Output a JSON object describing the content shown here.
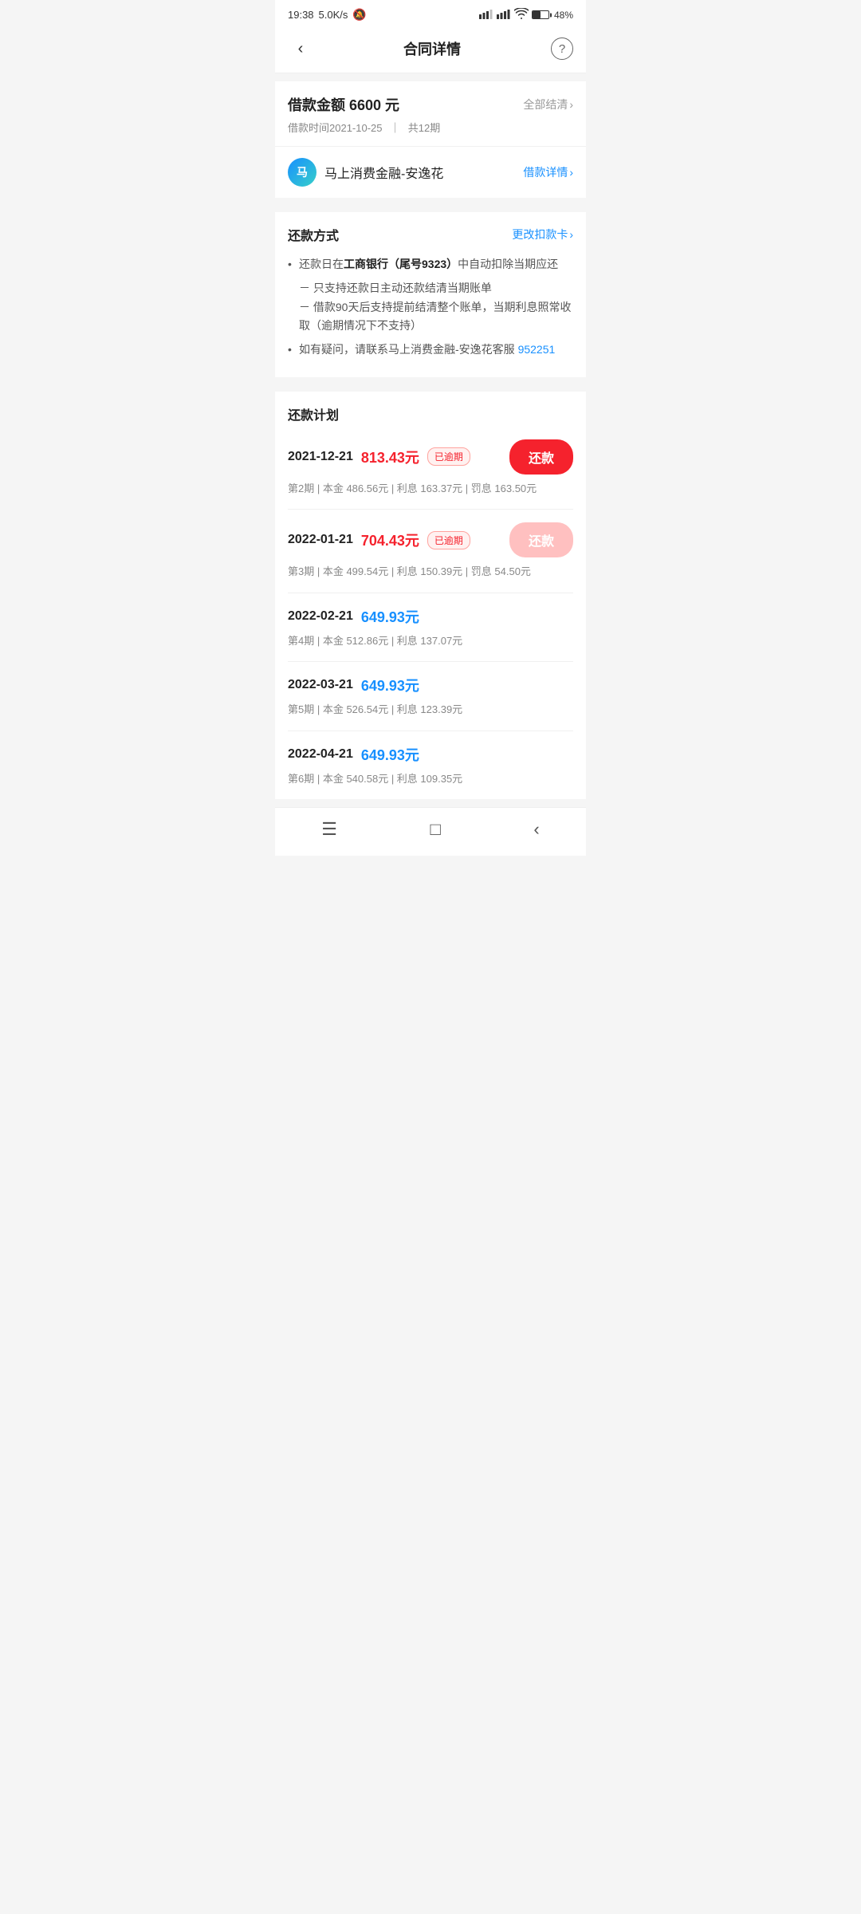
{
  "statusBar": {
    "time": "19:38",
    "network": "5.0K/s",
    "battery": "48%"
  },
  "nav": {
    "title": "合同详情",
    "helpLabel": "?",
    "backLabel": "‹"
  },
  "loanSummary": {
    "title": "借款金额 6600 元",
    "settleAll": "全部结清",
    "date": "借款时间2021-10-25",
    "periods": "共12期"
  },
  "lender": {
    "iconText": "马",
    "name": "马上消费金融-安逸花",
    "detailLabel": "借款详情"
  },
  "repayMethod": {
    "sectionTitle": "还款方式",
    "changeCardLabel": "更改扣款卡",
    "bullet1": "还款日在工商银行（尾号9323）中自动扣除当期应还",
    "bullet2": "－ 只支持还款日主动还款结清当期账单",
    "bullet3": "－ 借款90天后支持提前结清整个账单，当期利息照常收取（逾期情况下不支持）",
    "bullet4": "如有疑问，请联系马上消费金融-安逸花客服 952251",
    "bankHighlight": "工商银行（尾号9323）",
    "phone": "952251"
  },
  "repayPlan": {
    "sectionTitle": "还款计划",
    "items": [
      {
        "date": "2021-12-21",
        "amount": "813.43元",
        "amountType": "overdue",
        "badge": "已逾期",
        "hasButton": true,
        "buttonType": "active",
        "buttonLabel": "还款",
        "detail": "第2期 | 本金 486.56元 | 利息 163.37元 | 罚息 163.50元"
      },
      {
        "date": "2022-01-21",
        "amount": "704.43元",
        "amountType": "overdue",
        "badge": "已逾期",
        "hasButton": true,
        "buttonType": "light",
        "buttonLabel": "还款",
        "detail": "第3期 | 本金 499.54元 | 利息 150.39元 | 罚息 54.50元"
      },
      {
        "date": "2022-02-21",
        "amount": "649.93元",
        "amountType": "normal",
        "badge": "",
        "hasButton": false,
        "buttonLabel": "",
        "detail": "第4期 | 本金 512.86元 | 利息 137.07元"
      },
      {
        "date": "2022-03-21",
        "amount": "649.93元",
        "amountType": "normal",
        "badge": "",
        "hasButton": false,
        "buttonLabel": "",
        "detail": "第5期 | 本金 526.54元 | 利息 123.39元"
      },
      {
        "date": "2022-04-21",
        "amount": "649.93元",
        "amountType": "normal",
        "badge": "",
        "hasButton": false,
        "buttonLabel": "",
        "detail": "第6期 | 本金 540.58元 | 利息 109.35元"
      }
    ]
  },
  "bottomNav": {
    "menu": "☰",
    "home": "□",
    "back": "‹"
  }
}
